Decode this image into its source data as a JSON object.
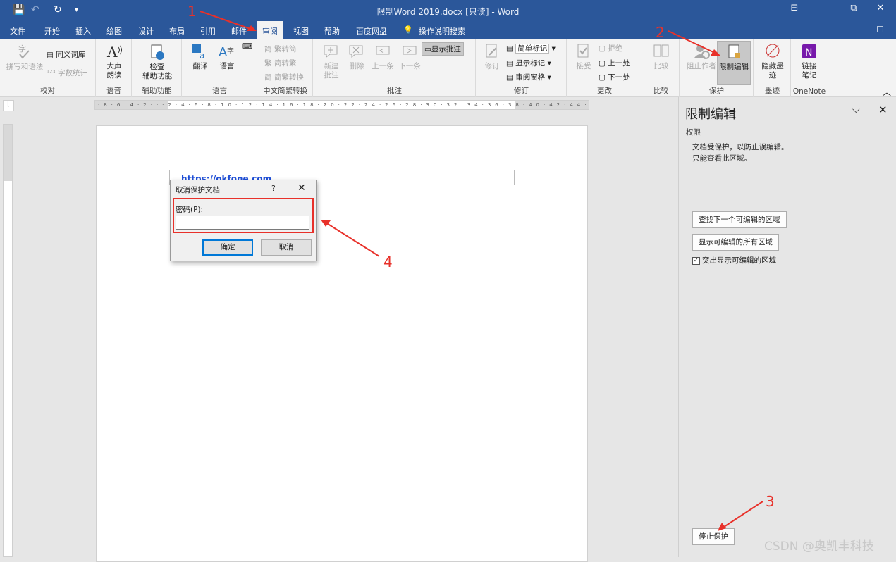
{
  "window": {
    "title": "限制Word 2019.docx [只读]  -  Word",
    "qa_save": "💾",
    "qa_undo": "↶",
    "qa_redo": "↻",
    "qa_more": "▾",
    "btn_options": "⊟",
    "btn_min": "—",
    "btn_max": "⧉",
    "btn_close": "✕",
    "comment_icon": "☐"
  },
  "tabs": [
    "文件",
    "开始",
    "插入",
    "绘图",
    "设计",
    "布局",
    "引用",
    "邮件",
    "审阅",
    "视图",
    "帮助",
    "百度网盘",
    "操作说明搜索"
  ],
  "active_tab": "审阅",
  "ribbon": {
    "groups": {
      "proofing": "校对",
      "speech": "语音",
      "accessibility": "辅助功能",
      "language": "语言",
      "chinese_conv": "中文简繁转换",
      "comments": "批注",
      "tracking": "修订",
      "changes": "更改",
      "compare": "比较",
      "protect": "保护",
      "ink": "墨迹",
      "onenote": "OneNote"
    },
    "buttons": {
      "spelling": "拼写和语法",
      "thesaurus": "同义词库",
      "word_count": "字数统计",
      "read_aloud_1": "大声",
      "read_aloud_2": "朗读",
      "check_1": "检查",
      "check_2": "辅助功能",
      "translate": "翻译",
      "language": "语言",
      "simp_to_trad": "繁转简",
      "trad_to_simp": "简转繁",
      "conv": "简繁转换",
      "new_comment_1": "新建",
      "new_comment_2": "批注",
      "delete": "删除",
      "prev": "上一条",
      "next": "下一条",
      "show_comments": "显示批注",
      "track": "修订",
      "simple_markup": "简单标记",
      "show_markup": "显示标记",
      "review_pane": "审阅窗格",
      "accept": "接受",
      "reject": "拒绝",
      "prev_change": "上一处",
      "next_change": "下一处",
      "compare": "比较",
      "block_authors": "阻止作者",
      "restrict_editing": "限制编辑",
      "hide_ink_1": "隐藏墨",
      "hide_ink_2": "迹",
      "link_notes_1": "链接",
      "link_notes_2": "笔记"
    }
  },
  "document": {
    "url_text": "https://okfone.com"
  },
  "dialog": {
    "title": "取消保护文档",
    "help": "?",
    "close": "✕",
    "password_label": "密码(P):",
    "password_value": "",
    "ok": "确定",
    "cancel": "取消"
  },
  "pane": {
    "title": "限制编辑",
    "chevron": "⌵",
    "close": "✕",
    "section": "权限",
    "line1": "文档受保护，以防止误编辑。",
    "line2": "只能查看此区域。",
    "find_next": "查找下一个可编辑的区域",
    "show_all": "显示可编辑的所有区域",
    "highlight_label": "突出显示可编辑的区域",
    "highlight_checked": true,
    "stop_protection": "停止保护"
  },
  "annotations": {
    "n1": "1",
    "n2": "2",
    "n3": "3",
    "n4": "4",
    "color": "#e8312a"
  },
  "watermark": "CSDN @奥凯丰科技",
  "colors": {
    "accent": "#2b579a"
  }
}
